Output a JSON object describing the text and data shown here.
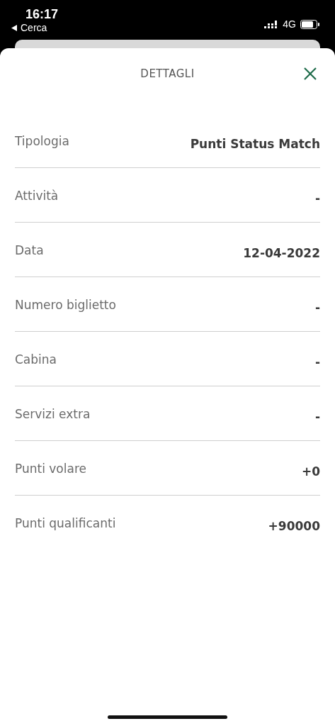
{
  "status_bar": {
    "time": "16:17",
    "back_label": "Cerca",
    "network": "4G"
  },
  "sheet": {
    "title": "DETTAGLI"
  },
  "details": [
    {
      "label": "Tipologia",
      "value": "Punti Status Match"
    },
    {
      "label": "Attività",
      "value": "-"
    },
    {
      "label": "Data",
      "value": "12-04-2022"
    },
    {
      "label": "Numero biglietto",
      "value": "-"
    },
    {
      "label": "Cabina",
      "value": "-"
    },
    {
      "label": "Servizi extra",
      "value": "-"
    },
    {
      "label": "Punti volare",
      "value": "+0"
    },
    {
      "label": "Punti qualificanti",
      "value": "+90000"
    }
  ]
}
